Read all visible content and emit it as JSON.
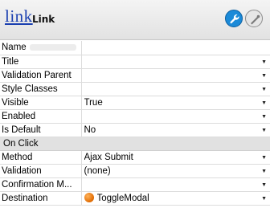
{
  "header": {
    "widget_kind": "link",
    "widget_name": "Link"
  },
  "properties": {
    "name": {
      "label": "Name",
      "value": ""
    },
    "title": {
      "label": "Title",
      "value": ""
    },
    "validation_parent": {
      "label": "Validation Parent",
      "value": ""
    },
    "style_classes": {
      "label": "Style Classes",
      "value": ""
    },
    "visible": {
      "label": "Visible",
      "value": "True"
    },
    "enabled": {
      "label": "Enabled",
      "value": ""
    },
    "is_default": {
      "label": "Is Default",
      "value": "No"
    }
  },
  "on_click": {
    "section_label": "On Click",
    "method": {
      "label": "Method",
      "value": "Ajax Submit"
    },
    "validation": {
      "label": "Validation",
      "value": "(none)"
    },
    "confirmation_message": {
      "label": "Confirmation M...",
      "value": ""
    },
    "destination": {
      "label": "Destination",
      "value": "ToggleModal",
      "icon": "orange-orb-icon"
    }
  },
  "dropdown_arrow": "▼"
}
